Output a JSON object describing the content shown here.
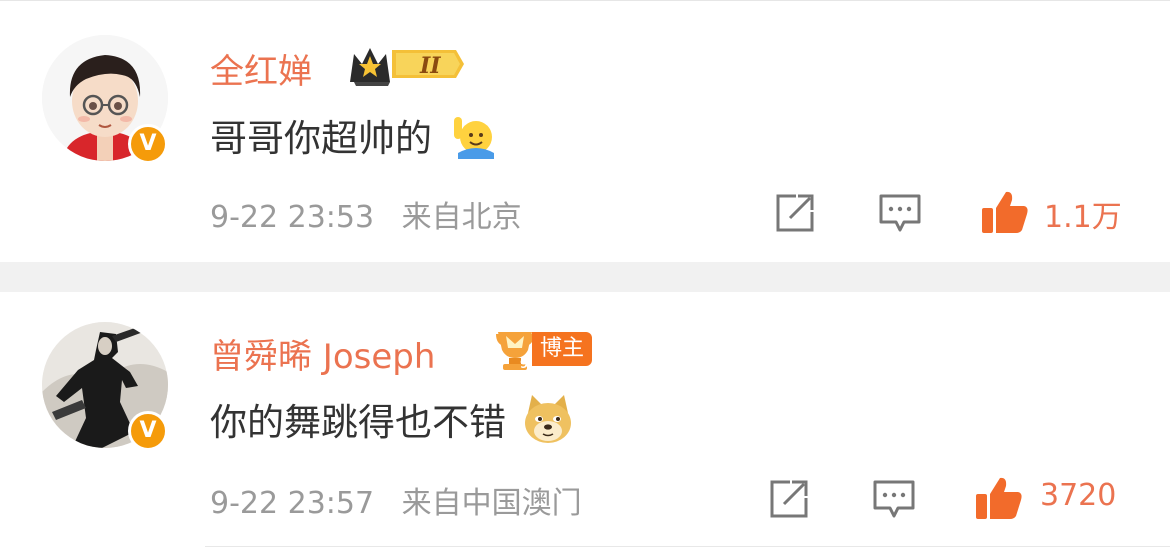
{
  "colors": {
    "accent": "#eb7350",
    "text": "#333333",
    "meta": "#9a9a9a",
    "verified": "#f59b0a"
  },
  "comments": [
    {
      "username": "全红婵",
      "badge": {
        "icon": "crown-level-icon",
        "level": "II"
      },
      "verified": "V",
      "text": "哥哥你超帅的",
      "emoji": "raising-hand-emoji",
      "time": "9-22 23:53",
      "location": "来自北京",
      "likes": "1.1万"
    },
    {
      "username": "曾舜晞 Joseph",
      "badge": {
        "icon": "trophy-badge-icon",
        "tag": "博主"
      },
      "verified": "V",
      "text": "你的舞跳得也不错",
      "emoji": "doge-emoji",
      "time": "9-22 23:57",
      "location": "来自中国澳门",
      "likes": "3720"
    }
  ]
}
